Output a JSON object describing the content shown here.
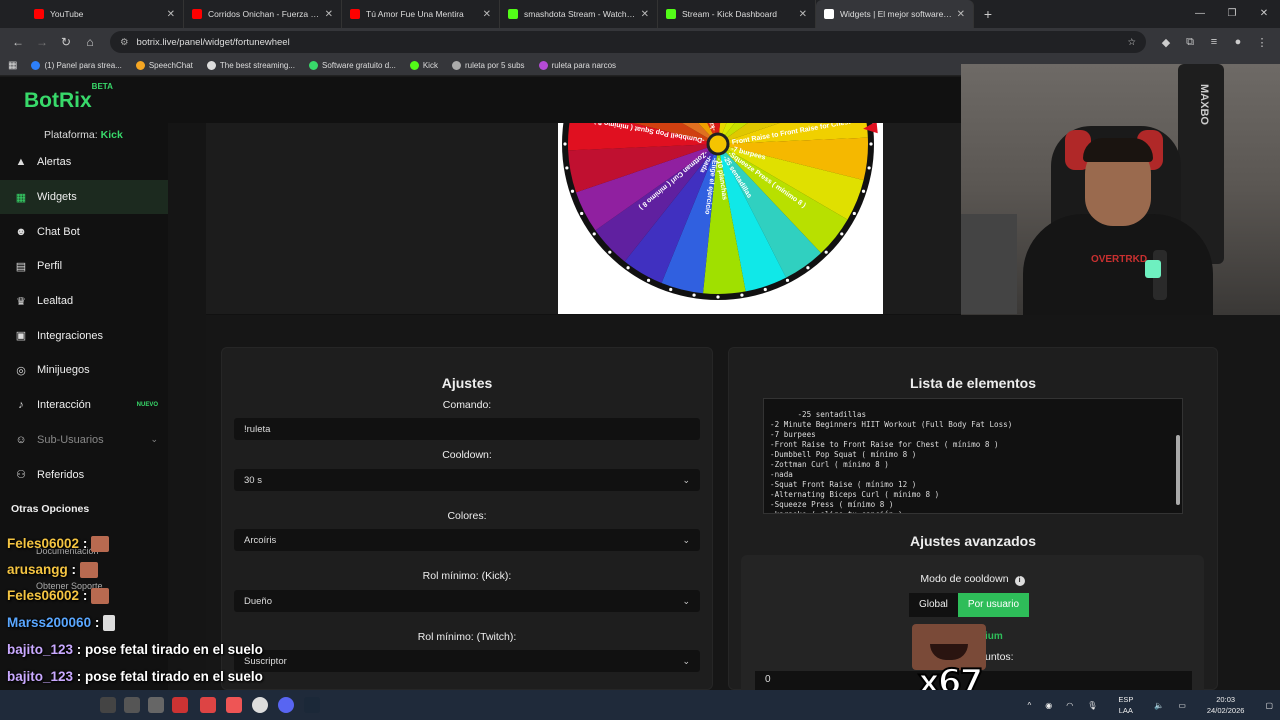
{
  "browser": {
    "tabs": [
      {
        "title": "YouTube",
        "color": "#ff0000"
      },
      {
        "title": "Corridos Onichan - Fuerza regi",
        "color": "#ff0000"
      },
      {
        "title": "Tú Amor Fue Una Mentira",
        "color": "#ff0000"
      },
      {
        "title": "smashdota Stream - Watch Live",
        "color": "#53fc18"
      },
      {
        "title": "Stream - Kick Dashboard",
        "color": "#53fc18"
      },
      {
        "title": "Widgets | El mejor software pa",
        "color": "#ffffff"
      }
    ],
    "url": "botrix.live/panel/widget/fortunewheel",
    "bookmarks": [
      {
        "label": "(1) Panel para strea...",
        "color": "#2d7ff9"
      },
      {
        "label": "SpeechChat",
        "color": "#f5a623"
      },
      {
        "label": "The best streaming...",
        "color": "#dddddd"
      },
      {
        "label": "Software gratuito d...",
        "color": "#38d96a"
      },
      {
        "label": "Kick",
        "color": "#53fc18"
      },
      {
        "label": "ruleta por 5 subs",
        "color": "#aaaaaa"
      },
      {
        "label": "ruleta para narcos",
        "color": "#b44bd6"
      }
    ]
  },
  "app": {
    "logo": "BotRix",
    "beta": "BETA",
    "platform_label": "Plataforma:",
    "platform_value": "Kick"
  },
  "sidebar": {
    "items": [
      {
        "label": "Alertas",
        "icon": "alert-icon"
      },
      {
        "label": "Widgets",
        "icon": "widgets-icon"
      },
      {
        "label": "Chat Bot",
        "icon": "robot-icon"
      },
      {
        "label": "Perfil",
        "icon": "profile-icon"
      },
      {
        "label": "Lealtad",
        "icon": "trophy-icon"
      },
      {
        "label": "Integraciones",
        "icon": "integrations-icon"
      },
      {
        "label": "Minijuegos",
        "icon": "gamepad-icon"
      },
      {
        "label": "Interacción",
        "icon": "music-icon",
        "badge": "NUEVO"
      },
      {
        "label": "Sub-Usuarios",
        "icon": "users-icon"
      },
      {
        "label": "Referidos",
        "icon": "referrals-icon"
      }
    ],
    "otras": "Otras Opciones",
    "sub": [
      "Documentación",
      "Obtener Soporte"
    ]
  },
  "ajustes": {
    "title": "Ajustes",
    "comando_label": "Comando:",
    "comando_value": "!ruleta",
    "cooldown_label": "Cooldown:",
    "cooldown_value": "30 s",
    "colores_label": "Colores:",
    "colores_value": "Arcoíris",
    "rol_kick_label": "Rol mínimo: (Kick):",
    "rol_kick_value": "Dueño",
    "rol_twitch_label": "Rol mínimo: (Twitch):",
    "rol_twitch_value": "Suscriptor"
  },
  "lista": {
    "title": "Lista de elementos",
    "items": "-25 sentadillas\n-2 Minute Beginners HIIT Workout (Full Body Fat Loss)\n-7 burpees\n-Front Raise to Front Raise for Chest ( mínimo 8 )\n-Dumbbell Pop Squat ( mínimo 8 )\n-Zottman Curl ( mínimo 8 )\n-nada\n-Squat Front Raise ( mínimo 12 )\n-Alternating Biceps Curl ( mínimo 8 )\n-Squeeze Press ( mínimo 8 )\n-karaoke ( elige tu canción )",
    "avanzados_title": "Ajustes avanzados",
    "modo_label": "Modo de cooldown",
    "global": "Global",
    "por_usuario": "Por usuario",
    "premium_fragment": "ium",
    "puntos_fragment": "untos:",
    "value_zero": "0"
  },
  "wheel": {
    "labels": [
      "Front Raise to Front Raise for Chest",
      "-7 burpees",
      "-Squeeze Press ( mínimo 8 )",
      "-25 sentadillas",
      "-10 planchas",
      "-Elige el ejercicio",
      "-nada",
      "-Zottman Curl ( mínimo 8 )",
      "-Dumbbell Pop Squat ( mínimo 8 )",
      "-karaoke"
    ]
  },
  "chat": [
    {
      "user": "Feles06002",
      "msg": ":",
      "cls": "u1"
    },
    {
      "user": "arusangg",
      "msg": ":",
      "cls": "u2"
    },
    {
      "user": "Feles06002",
      "msg": ":",
      "cls": "u1"
    },
    {
      "user": "Marss200060",
      "msg": ":",
      "cls": "u3"
    },
    {
      "user": "bajito_123",
      "msg": ": pose fetal tirado en el suelo",
      "cls": "u4"
    },
    {
      "user": "bajito_123",
      "msg": ": pose fetal tirado en el suelo",
      "cls": "u4"
    },
    {
      "user": "bajito_123",
      "msg": ": pose fetal tirado en el suelo",
      "cls": "u4"
    }
  ],
  "overlay": {
    "emote_count": "x67",
    "shirt_print": "OVERTRKD",
    "bag_text": "MAXBO"
  },
  "taskbar": {
    "lang1": "ESP",
    "lang2": "LAA",
    "time": "20:03",
    "date": "24/02/2026"
  }
}
